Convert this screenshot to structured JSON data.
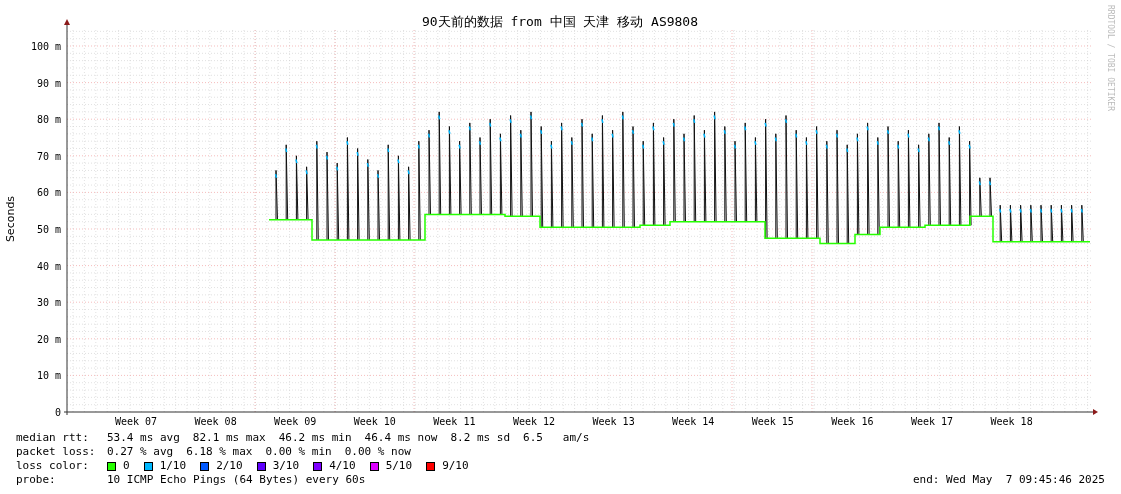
{
  "title": "90天前的数据 from 中国 天津 移动 AS9808",
  "y_axis_label": "Seconds",
  "credit": "RRDTOOL / TOBI OETIKER",
  "y_ticks": [
    "100 m",
    "90 m",
    "80 m",
    "70 m",
    "60 m",
    "50 m",
    "40 m",
    "30 m",
    "20 m",
    "10 m",
    "0"
  ],
  "x_ticks": [
    "Week 07",
    "Week 08",
    "Week 09",
    "Week 10",
    "Week 11",
    "Week 12",
    "Week 13",
    "Week 14",
    "Week 15",
    "Week 16",
    "Week 17",
    "Week 18"
  ],
  "legend": {
    "median_rtt": {
      "label": "median rtt:",
      "values": [
        "53.4 ms avg",
        "82.1 ms max",
        "46.2 ms min",
        "46.4 ms now",
        "8.2 ms sd",
        "6.5   am/s"
      ]
    },
    "packet_loss": {
      "label": "packet loss:",
      "values": [
        "0.27 % avg",
        "6.18 % max",
        "0.00 % min",
        "0.00 % now"
      ]
    },
    "loss_color": {
      "label": "loss color:",
      "items": [
        {
          "label": "0",
          "color": "#26ff00"
        },
        {
          "label": "1/10",
          "color": "#00b8ff"
        },
        {
          "label": "2/10",
          "color": "#0059ff"
        },
        {
          "label": "3/10",
          "color": "#5e00ff"
        },
        {
          "label": "4/10",
          "color": "#7e00ff"
        },
        {
          "label": "5/10",
          "color": "#dd00ff"
        },
        {
          "label": "9/10",
          "color": "#ff0000"
        }
      ]
    },
    "probe": {
      "label": "probe:",
      "value": "10 ICMP Echo Pings (64 Bytes) every 60s"
    },
    "end": "end: Wed May  7 09:45:46 2025"
  }
}
